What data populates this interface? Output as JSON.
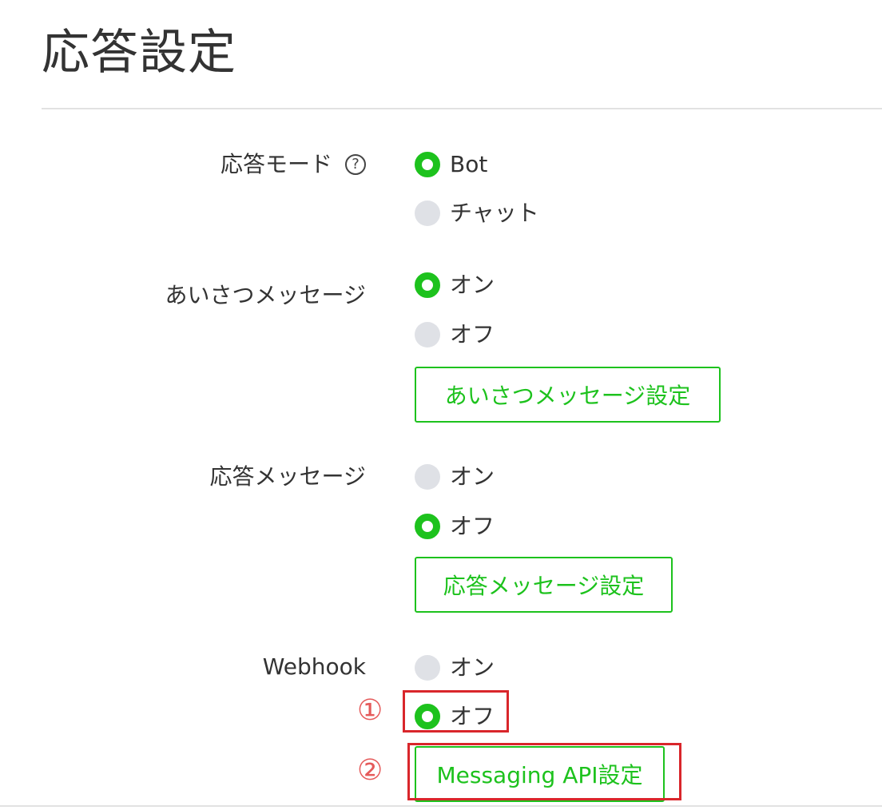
{
  "page": {
    "title": "応答設定"
  },
  "colors": {
    "accent": "#1dc21d",
    "radio_off": "#dfe1e6",
    "annotation": "#d9262b"
  },
  "settings": {
    "response_mode": {
      "label": "応答モード",
      "help_icon": "question-circle-icon",
      "help_glyph": "?",
      "options": [
        {
          "label": "Bot",
          "selected": true
        },
        {
          "label": "チャット",
          "selected": false
        }
      ]
    },
    "greeting_message": {
      "label": "あいさつメッセージ",
      "options": [
        {
          "label": "オン",
          "selected": true
        },
        {
          "label": "オフ",
          "selected": false
        }
      ],
      "button_label": "あいさつメッセージ設定"
    },
    "auto_response": {
      "label": "応答メッセージ",
      "options": [
        {
          "label": "オン",
          "selected": false
        },
        {
          "label": "オフ",
          "selected": true
        }
      ],
      "button_label": "応答メッセージ設定"
    },
    "webhook": {
      "label": "Webhook",
      "options": [
        {
          "label": "オン",
          "selected": false
        },
        {
          "label": "オフ",
          "selected": true
        }
      ],
      "button_label": "Messaging API設定"
    }
  },
  "annotations": {
    "step1": "①",
    "step2": "②"
  }
}
